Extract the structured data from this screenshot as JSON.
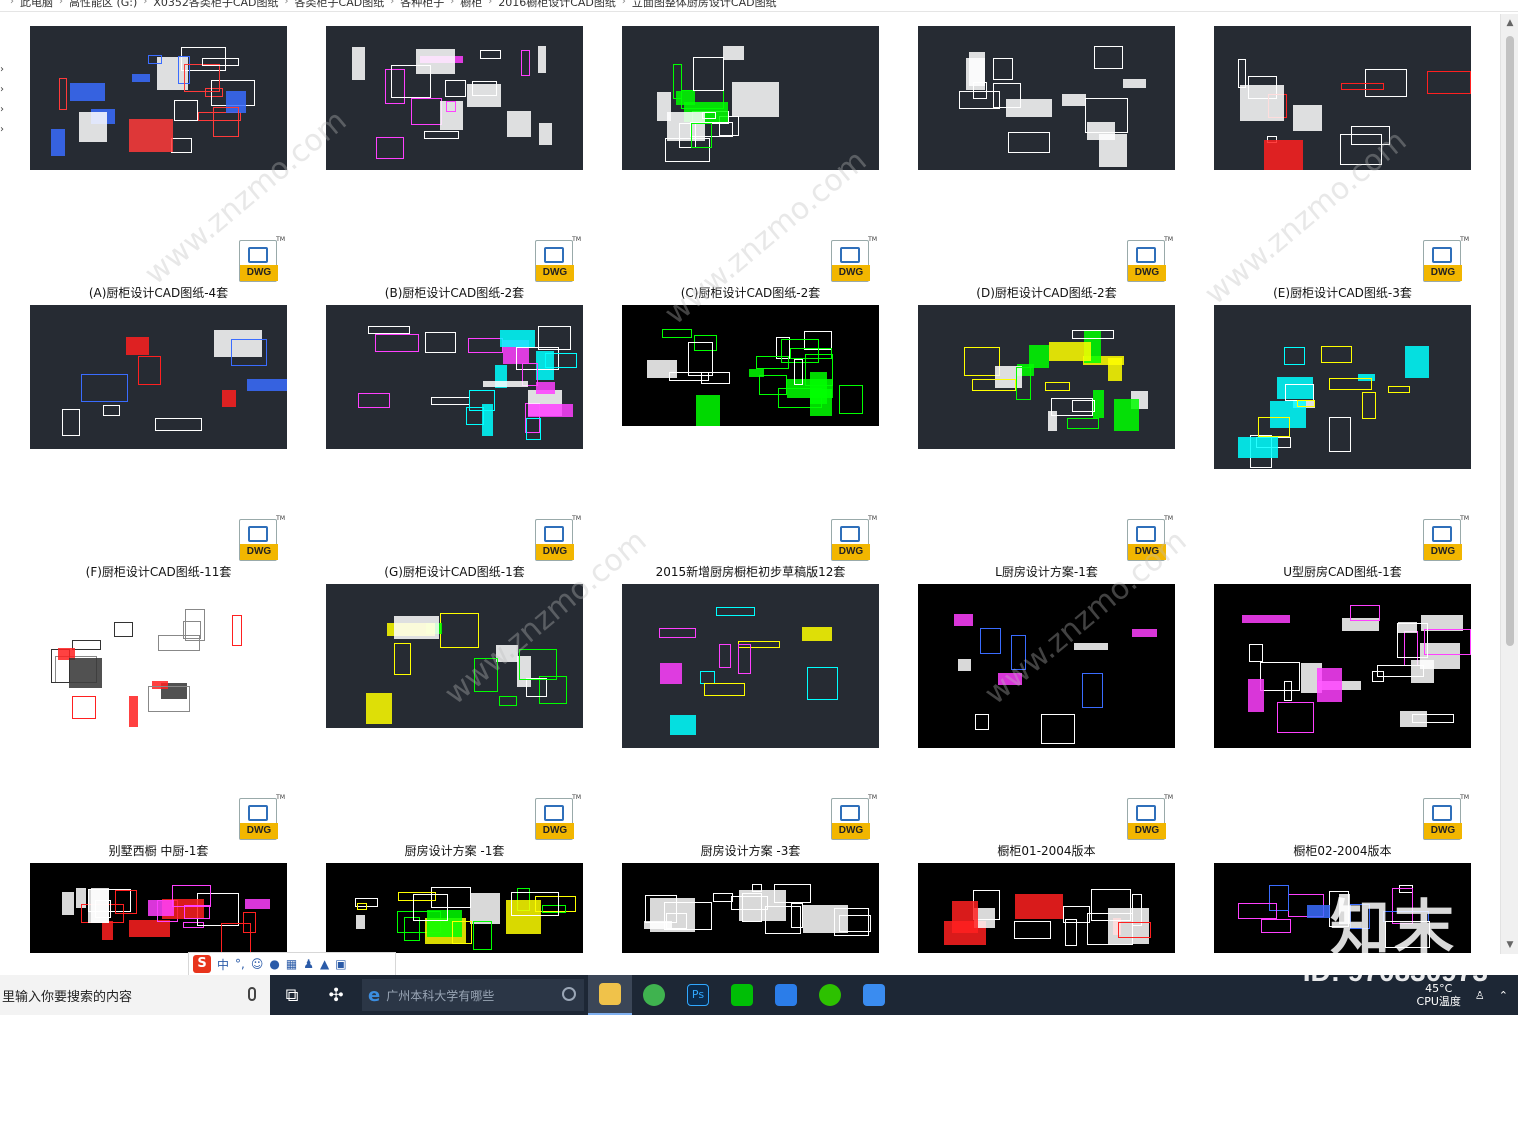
{
  "breadcrumb": [
    "此电脑",
    "高性能区 (G:)",
    "X0352各类柜子CAD图纸",
    "各类柜子CAD图纸",
    "各种柜子",
    "橱柜",
    "2016橱柜设计CAD图纸",
    "立面图整体厨房设计CAD图纸"
  ],
  "files": [
    {
      "label": "(A)厨柜设计CAD图纸-4套",
      "type": "DWG",
      "bg": "#262b33"
    },
    {
      "label": "(B)厨柜设计CAD图纸-2套",
      "type": "DWG",
      "bg": "#262b33"
    },
    {
      "label": "(C)厨柜设计CAD图纸-2套",
      "type": "DWG",
      "bg": "#262b33"
    },
    {
      "label": "(D)厨柜设计CAD图纸-2套",
      "type": "DWG",
      "bg": "#262b33"
    },
    {
      "label": "(E)厨柜设计CAD图纸-3套",
      "type": "DWG",
      "bg": "#262b33"
    },
    {
      "label": "(F)厨柜设计CAD图纸-11套",
      "type": "DWG",
      "bg": "#262b33"
    },
    {
      "label": "(G)厨柜设计CAD图纸-1套",
      "type": "DWG",
      "bg": "#262b33"
    },
    {
      "label": "2015新增厨房橱柜初步草稿版12套",
      "type": "DWG",
      "bg": "#000000"
    },
    {
      "label": "L厨房设计方案-1套",
      "type": "DWG",
      "bg": "#262b33"
    },
    {
      "label": "U型厨房CAD图纸-1套",
      "type": "DWG",
      "bg": "#262b33"
    },
    {
      "label": "别墅西橱 中厨-1套",
      "type": "DWG",
      "bg": "#ffffff"
    },
    {
      "label": "厨房设计方案 -1套",
      "type": "DWG",
      "bg": "#262b33"
    },
    {
      "label": "厨房设计方案 -3套",
      "type": "DWG",
      "bg": "#262b33"
    },
    {
      "label": "橱柜01-2004版本",
      "type": "DWG",
      "bg": "#000000"
    },
    {
      "label": "橱柜02-2004版本",
      "type": "DWG",
      "bg": "#000000"
    },
    {
      "label": "",
      "type": "DWG",
      "bg": "#000000"
    },
    {
      "label": "",
      "type": "DWG",
      "bg": "#000000"
    },
    {
      "label": "",
      "type": "DWG",
      "bg": "#000000"
    },
    {
      "label": "",
      "type": "DWG",
      "bg": "#000000"
    },
    {
      "label": "",
      "type": "DWG",
      "bg": "#000000"
    }
  ],
  "ime": {
    "logo": "S",
    "lang": "中",
    "punct": "°,"
  },
  "taskbar": {
    "search_placeholder": "里输入你要搜索的内容",
    "address_text": "广州本科大学有哪些",
    "temp_value": "45°C",
    "temp_label": "CPU温度"
  },
  "watermark": {
    "brand": "知末",
    "id": "ID: 970830973"
  }
}
